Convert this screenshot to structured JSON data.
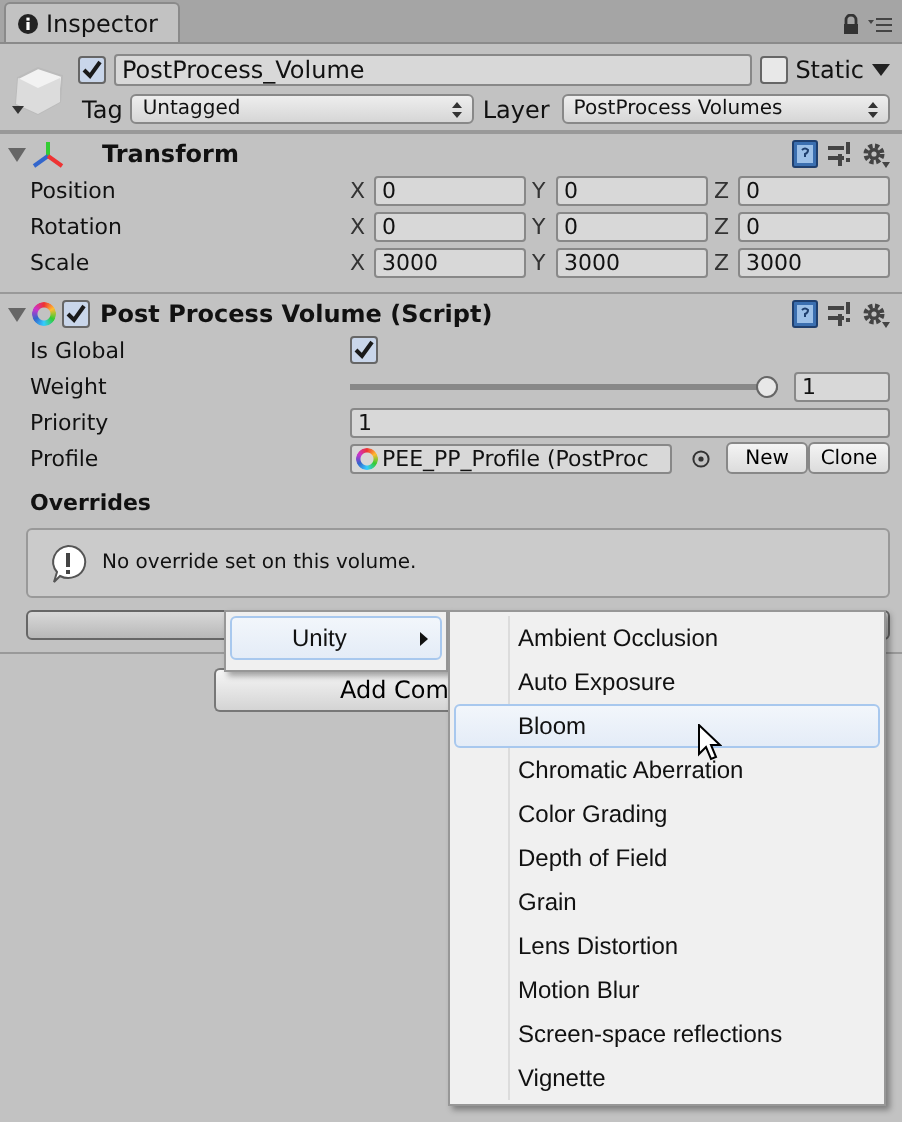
{
  "tab": {
    "label": "Inspector"
  },
  "object": {
    "active": true,
    "name": "PostProcess_Volume",
    "static_label": "Static",
    "static": false,
    "tag_label": "Tag",
    "tag": "Untagged",
    "layer_label": "Layer",
    "layer": "PostProcess Volumes"
  },
  "transform": {
    "title": "Transform",
    "expanded": true,
    "rows": [
      {
        "label": "Position",
        "fields": [
          {
            "axis": "X",
            "value": "0"
          },
          {
            "axis": "Y",
            "value": "0"
          },
          {
            "axis": "Z",
            "value": "0"
          }
        ]
      },
      {
        "label": "Rotation",
        "fields": [
          {
            "axis": "X",
            "value": "0"
          },
          {
            "axis": "Y",
            "value": "0"
          },
          {
            "axis": "Z",
            "value": "0"
          }
        ]
      },
      {
        "label": "Scale",
        "fields": [
          {
            "axis": "X",
            "value": "3000"
          },
          {
            "axis": "Y",
            "value": "3000"
          },
          {
            "axis": "Z",
            "value": "3000"
          }
        ]
      }
    ]
  },
  "volume": {
    "title": "Post Process Volume (Script)",
    "enabled": true,
    "expanded": true,
    "is_global": {
      "label": "Is Global",
      "checked": true
    },
    "weight": {
      "label": "Weight",
      "level": 1,
      "value": "1"
    },
    "priority": {
      "label": "Priority",
      "value": "1"
    },
    "profile": {
      "label": "Profile",
      "value": "PEE_PP_Profile (PostProc",
      "buttons": [
        "New",
        "Clone"
      ]
    },
    "overrides_title": "Overrides",
    "help": "No override set on this volume."
  },
  "add_component": {
    "label": "Add Com"
  },
  "context_menu": {
    "items": [
      {
        "label": "Unity",
        "selected": true
      }
    ]
  },
  "submenu": {
    "items": [
      {
        "label": "Ambient Occlusion",
        "selected": false
      },
      {
        "label": "Auto Exposure",
        "selected": false
      },
      {
        "label": "Bloom",
        "selected": true
      },
      {
        "label": "Chromatic Aberration",
        "selected": false
      },
      {
        "label": "Color Grading",
        "selected": false
      },
      {
        "label": "Depth of Field",
        "selected": false
      },
      {
        "label": "Grain",
        "selected": false
      },
      {
        "label": "Lens Distortion",
        "selected": false
      },
      {
        "label": "Motion Blur",
        "selected": false
      },
      {
        "label": "Screen-space reflections",
        "selected": false
      },
      {
        "label": "Vignette",
        "selected": false
      }
    ]
  }
}
